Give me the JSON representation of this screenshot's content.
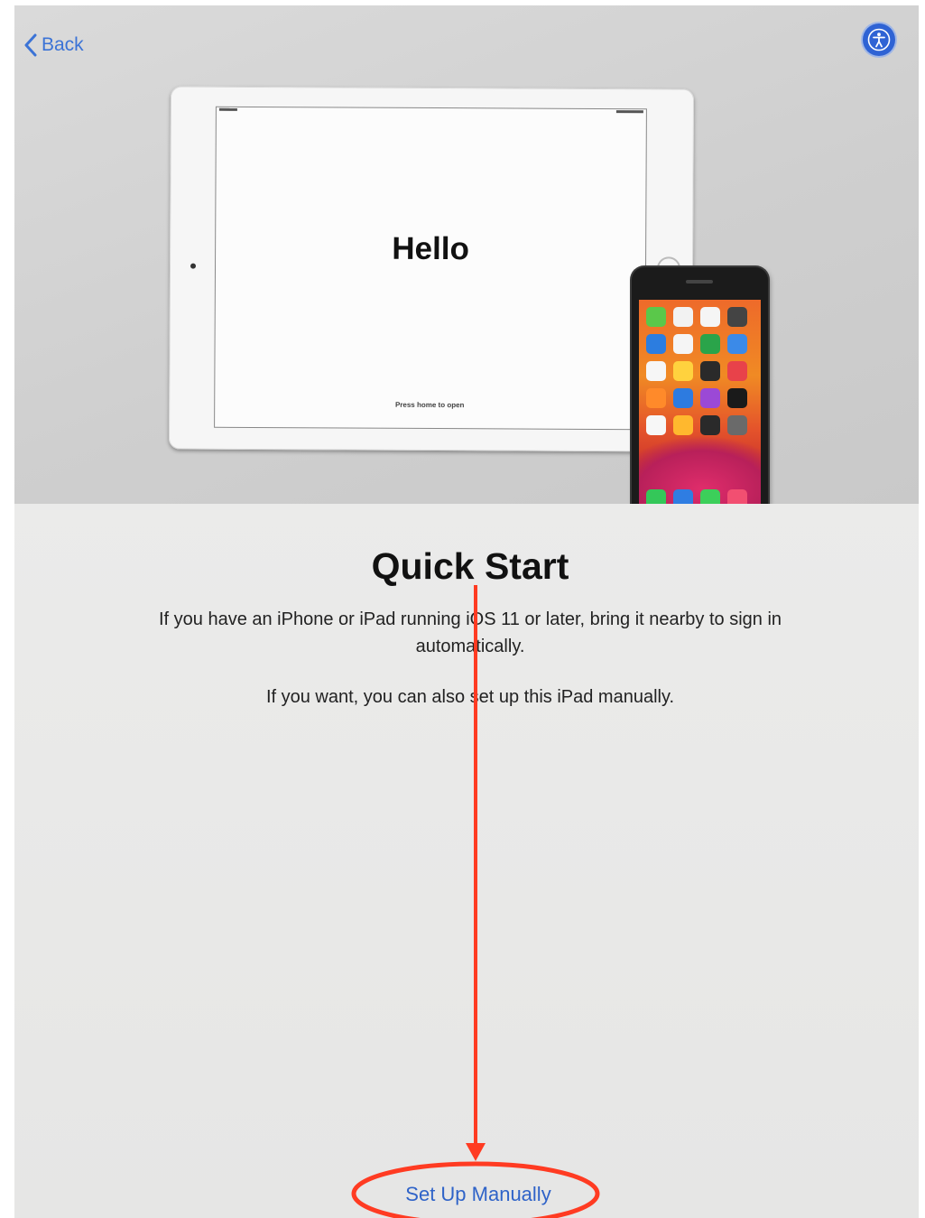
{
  "nav": {
    "back_label": "Back",
    "accessibility_icon": "accessibility-icon"
  },
  "hero": {
    "ipad_greeting": "Hello",
    "ipad_hint": "Press home to open",
    "iphone_apps": [
      "#5ac84a",
      "#f2f2f2",
      "#f5f5f5",
      "#444444",
      "#2c7de0",
      "#f5f5f5",
      "#2aa44a",
      "#3b8ae8",
      "#f6f6f6",
      "#ffd23e",
      "#2a2a2a",
      "#e8424a",
      "#ff8a2a",
      "#2d7be0",
      "#9b49d6",
      "#1a1a1a",
      "#f7f7f7",
      "#ffb82e",
      "#2a2a2a",
      "#6a6a6a"
    ],
    "iphone_dock": [
      "#34c759",
      "#2f7de2",
      "#3ccf5a",
      "#f24f71"
    ]
  },
  "main": {
    "title": "Quick Start",
    "paragraph_1": "If you have an iPhone or iPad running iOS 11 or later, bring it nearby to sign in automatically.",
    "paragraph_2": "If you want, you can also set up this iPad manually.",
    "setup_manually_label": "Set Up Manually"
  },
  "annotation": {
    "color": "#ff3b22"
  },
  "colors": {
    "accent_blue": "#2f63c8"
  }
}
